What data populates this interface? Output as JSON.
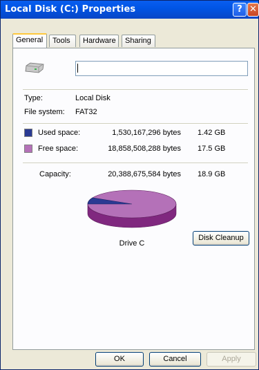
{
  "window": {
    "title": "Local Disk (C:) Properties"
  },
  "titlebar": {
    "help_glyph": "?",
    "close_glyph": "✕"
  },
  "tabs": [
    {
      "label": "General",
      "active": true
    },
    {
      "label": "Tools",
      "active": false
    },
    {
      "label": "Hardware",
      "active": false
    },
    {
      "label": "Sharing",
      "active": false
    }
  ],
  "general": {
    "drive_icon": "hard-drive-icon",
    "label_value": "",
    "type_label": "Type:",
    "type_value": "Local Disk",
    "fs_label": "File system:",
    "fs_value": "FAT32",
    "used": {
      "label": "Used space:",
      "bytes": "1,530,167,296 bytes",
      "size": "1.42 GB",
      "color": "#2a3a93"
    },
    "free": {
      "label": "Free space:",
      "bytes": "18,858,508,288 bytes",
      "size": "17.5 GB",
      "color": "#b471b8"
    },
    "capacity": {
      "label": "Capacity:",
      "bytes": "20,388,675,584 bytes",
      "size": "18.9 GB"
    },
    "pie": {
      "used_fraction": 0.075,
      "used_color": "#2a3a93",
      "free_color": "#b471b8",
      "free_side_color": "#80287f"
    },
    "drive_caption": "Drive C",
    "cleanup_button": "Disk Cleanup"
  },
  "buttons": {
    "ok": "OK",
    "cancel": "Cancel",
    "apply": "Apply"
  }
}
